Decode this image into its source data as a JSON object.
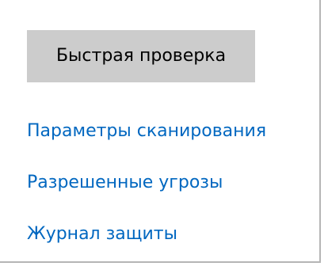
{
  "actions": {
    "quick_scan_label": "Быстрая проверка"
  },
  "links": [
    {
      "label": "Параметры сканирования"
    },
    {
      "label": "Разрешенные угрозы"
    },
    {
      "label": "Журнал защиты"
    }
  ],
  "colors": {
    "link": "#0067c0",
    "button_bg": "#cccccc",
    "panel_border": "#b5b5b5"
  }
}
